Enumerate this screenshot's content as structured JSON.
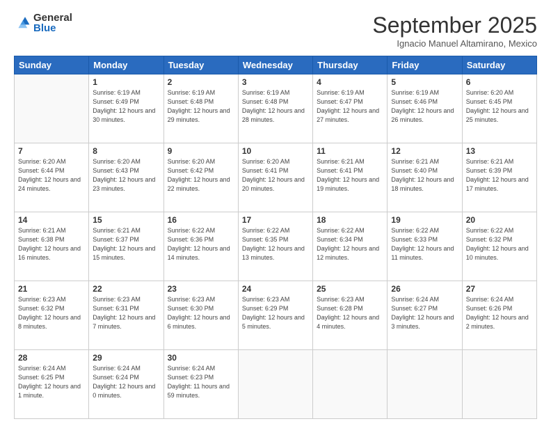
{
  "logo": {
    "general": "General",
    "blue": "Blue"
  },
  "header": {
    "month": "September 2025",
    "location": "Ignacio Manuel Altamirano, Mexico"
  },
  "weekdays": [
    "Sunday",
    "Monday",
    "Tuesday",
    "Wednesday",
    "Thursday",
    "Friday",
    "Saturday"
  ],
  "weeks": [
    [
      {
        "day": "",
        "sunrise": "",
        "sunset": "",
        "daylight": ""
      },
      {
        "day": "1",
        "sunrise": "Sunrise: 6:19 AM",
        "sunset": "Sunset: 6:49 PM",
        "daylight": "Daylight: 12 hours and 30 minutes."
      },
      {
        "day": "2",
        "sunrise": "Sunrise: 6:19 AM",
        "sunset": "Sunset: 6:48 PM",
        "daylight": "Daylight: 12 hours and 29 minutes."
      },
      {
        "day": "3",
        "sunrise": "Sunrise: 6:19 AM",
        "sunset": "Sunset: 6:48 PM",
        "daylight": "Daylight: 12 hours and 28 minutes."
      },
      {
        "day": "4",
        "sunrise": "Sunrise: 6:19 AM",
        "sunset": "Sunset: 6:47 PM",
        "daylight": "Daylight: 12 hours and 27 minutes."
      },
      {
        "day": "5",
        "sunrise": "Sunrise: 6:19 AM",
        "sunset": "Sunset: 6:46 PM",
        "daylight": "Daylight: 12 hours and 26 minutes."
      },
      {
        "day": "6",
        "sunrise": "Sunrise: 6:20 AM",
        "sunset": "Sunset: 6:45 PM",
        "daylight": "Daylight: 12 hours and 25 minutes."
      }
    ],
    [
      {
        "day": "7",
        "sunrise": "Sunrise: 6:20 AM",
        "sunset": "Sunset: 6:44 PM",
        "daylight": "Daylight: 12 hours and 24 minutes."
      },
      {
        "day": "8",
        "sunrise": "Sunrise: 6:20 AM",
        "sunset": "Sunset: 6:43 PM",
        "daylight": "Daylight: 12 hours and 23 minutes."
      },
      {
        "day": "9",
        "sunrise": "Sunrise: 6:20 AM",
        "sunset": "Sunset: 6:42 PM",
        "daylight": "Daylight: 12 hours and 22 minutes."
      },
      {
        "day": "10",
        "sunrise": "Sunrise: 6:20 AM",
        "sunset": "Sunset: 6:41 PM",
        "daylight": "Daylight: 12 hours and 20 minutes."
      },
      {
        "day": "11",
        "sunrise": "Sunrise: 6:21 AM",
        "sunset": "Sunset: 6:41 PM",
        "daylight": "Daylight: 12 hours and 19 minutes."
      },
      {
        "day": "12",
        "sunrise": "Sunrise: 6:21 AM",
        "sunset": "Sunset: 6:40 PM",
        "daylight": "Daylight: 12 hours and 18 minutes."
      },
      {
        "day": "13",
        "sunrise": "Sunrise: 6:21 AM",
        "sunset": "Sunset: 6:39 PM",
        "daylight": "Daylight: 12 hours and 17 minutes."
      }
    ],
    [
      {
        "day": "14",
        "sunrise": "Sunrise: 6:21 AM",
        "sunset": "Sunset: 6:38 PM",
        "daylight": "Daylight: 12 hours and 16 minutes."
      },
      {
        "day": "15",
        "sunrise": "Sunrise: 6:21 AM",
        "sunset": "Sunset: 6:37 PM",
        "daylight": "Daylight: 12 hours and 15 minutes."
      },
      {
        "day": "16",
        "sunrise": "Sunrise: 6:22 AM",
        "sunset": "Sunset: 6:36 PM",
        "daylight": "Daylight: 12 hours and 14 minutes."
      },
      {
        "day": "17",
        "sunrise": "Sunrise: 6:22 AM",
        "sunset": "Sunset: 6:35 PM",
        "daylight": "Daylight: 12 hours and 13 minutes."
      },
      {
        "day": "18",
        "sunrise": "Sunrise: 6:22 AM",
        "sunset": "Sunset: 6:34 PM",
        "daylight": "Daylight: 12 hours and 12 minutes."
      },
      {
        "day": "19",
        "sunrise": "Sunrise: 6:22 AM",
        "sunset": "Sunset: 6:33 PM",
        "daylight": "Daylight: 12 hours and 11 minutes."
      },
      {
        "day": "20",
        "sunrise": "Sunrise: 6:22 AM",
        "sunset": "Sunset: 6:32 PM",
        "daylight": "Daylight: 12 hours and 10 minutes."
      }
    ],
    [
      {
        "day": "21",
        "sunrise": "Sunrise: 6:23 AM",
        "sunset": "Sunset: 6:32 PM",
        "daylight": "Daylight: 12 hours and 8 minutes."
      },
      {
        "day": "22",
        "sunrise": "Sunrise: 6:23 AM",
        "sunset": "Sunset: 6:31 PM",
        "daylight": "Daylight: 12 hours and 7 minutes."
      },
      {
        "day": "23",
        "sunrise": "Sunrise: 6:23 AM",
        "sunset": "Sunset: 6:30 PM",
        "daylight": "Daylight: 12 hours and 6 minutes."
      },
      {
        "day": "24",
        "sunrise": "Sunrise: 6:23 AM",
        "sunset": "Sunset: 6:29 PM",
        "daylight": "Daylight: 12 hours and 5 minutes."
      },
      {
        "day": "25",
        "sunrise": "Sunrise: 6:23 AM",
        "sunset": "Sunset: 6:28 PM",
        "daylight": "Daylight: 12 hours and 4 minutes."
      },
      {
        "day": "26",
        "sunrise": "Sunrise: 6:24 AM",
        "sunset": "Sunset: 6:27 PM",
        "daylight": "Daylight: 12 hours and 3 minutes."
      },
      {
        "day": "27",
        "sunrise": "Sunrise: 6:24 AM",
        "sunset": "Sunset: 6:26 PM",
        "daylight": "Daylight: 12 hours and 2 minutes."
      }
    ],
    [
      {
        "day": "28",
        "sunrise": "Sunrise: 6:24 AM",
        "sunset": "Sunset: 6:25 PM",
        "daylight": "Daylight: 12 hours and 1 minute."
      },
      {
        "day": "29",
        "sunrise": "Sunrise: 6:24 AM",
        "sunset": "Sunset: 6:24 PM",
        "daylight": "Daylight: 12 hours and 0 minutes."
      },
      {
        "day": "30",
        "sunrise": "Sunrise: 6:24 AM",
        "sunset": "Sunset: 6:23 PM",
        "daylight": "Daylight: 11 hours and 59 minutes."
      },
      {
        "day": "",
        "sunrise": "",
        "sunset": "",
        "daylight": ""
      },
      {
        "day": "",
        "sunrise": "",
        "sunset": "",
        "daylight": ""
      },
      {
        "day": "",
        "sunrise": "",
        "sunset": "",
        "daylight": ""
      },
      {
        "day": "",
        "sunrise": "",
        "sunset": "",
        "daylight": ""
      }
    ]
  ]
}
